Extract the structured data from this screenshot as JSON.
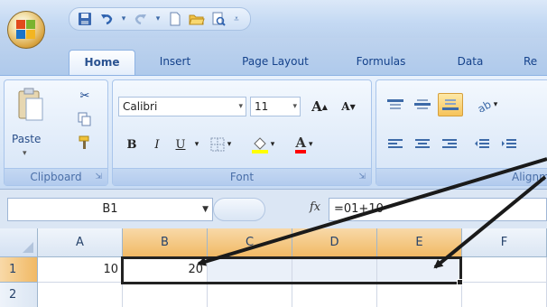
{
  "qat": {
    "icons": [
      "save-icon",
      "undo-icon",
      "redo-icon",
      "new-document-icon",
      "open-folder-icon",
      "print-preview-icon",
      "customize-qat-icon"
    ]
  },
  "tabs": [
    {
      "label": "Home",
      "active": true
    },
    {
      "label": "Insert",
      "active": false
    },
    {
      "label": "Page Layout",
      "active": false
    },
    {
      "label": "Formulas",
      "active": false
    },
    {
      "label": "Data",
      "active": false
    },
    {
      "label": "Re",
      "active": false
    }
  ],
  "ribbon": {
    "clipboard": {
      "label": "Clipboard",
      "paste_label": "Paste"
    },
    "font": {
      "label": "Font",
      "font_name": "Calibri",
      "font_size": "11",
      "bold": "B",
      "italic": "I",
      "underline": "U",
      "grow": "A",
      "shrink": "A",
      "font_color": "A"
    },
    "alignment": {
      "label": "Alignm"
    }
  },
  "formula_bar": {
    "name_box": "B1",
    "fx": "fx",
    "formula": "=01+10"
  },
  "grid": {
    "columns": [
      "A",
      "B",
      "C",
      "D",
      "E",
      "F"
    ],
    "rows": [
      "1",
      "2"
    ],
    "cells": {
      "A1": "10",
      "B1": "20"
    }
  },
  "colors": {
    "selection_header": "#f1b964",
    "ribbon_bg": "#d6e5f7",
    "tab_bg": "#bed3ee"
  }
}
